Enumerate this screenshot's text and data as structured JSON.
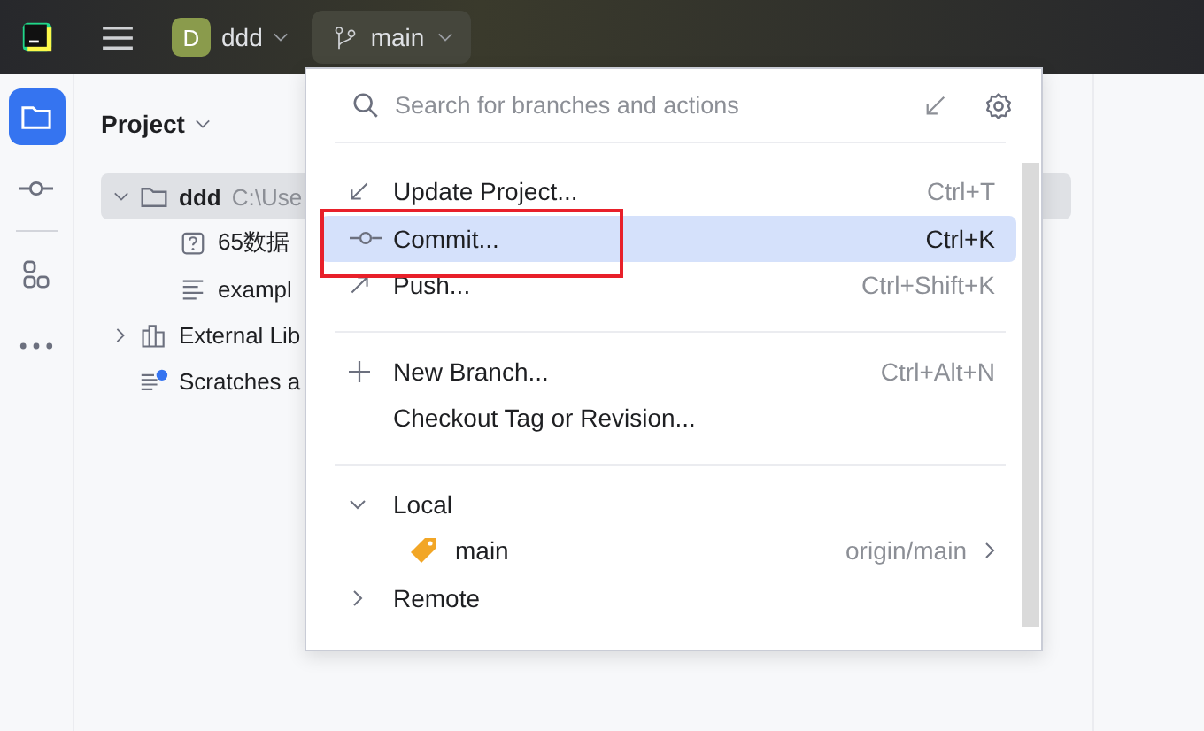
{
  "top_bar": {
    "project": {
      "badge": "D",
      "name": "ddd"
    },
    "branch": {
      "name": "main"
    }
  },
  "tool_strip": [
    {
      "kind": "folder",
      "selected": true
    },
    {
      "kind": "commit",
      "selected": false
    },
    {
      "kind": "structure",
      "selected": false
    },
    {
      "kind": "more",
      "selected": false
    }
  ],
  "project_panel": {
    "title": "Project",
    "tree": [
      {
        "kind": "folder",
        "label": "ddd",
        "path": "C:\\Use",
        "expanded": true,
        "selected": true,
        "children": [
          {
            "kind": "unknown",
            "label": "65数据",
            "selected": false
          },
          {
            "kind": "text",
            "label": "exampl",
            "selected": false
          }
        ]
      },
      {
        "kind": "library",
        "label": "External Lib",
        "expanded": false,
        "selected": false
      },
      {
        "kind": "scratches",
        "label": "Scratches a",
        "selected": false
      }
    ]
  },
  "branch_popup": {
    "search": {
      "placeholder": "Search for branches and actions"
    },
    "groups": [
      [
        {
          "kind": "update",
          "label": "Update Project...",
          "shortcut": "Ctrl+T",
          "selected": false
        },
        {
          "kind": "commit",
          "label": "Commit...",
          "shortcut": "Ctrl+K",
          "selected": true
        },
        {
          "kind": "push",
          "label": "Push...",
          "shortcut": "Ctrl+Shift+K",
          "selected": false
        }
      ],
      [
        {
          "kind": "new",
          "label": "New Branch...",
          "shortcut": "Ctrl+Alt+N",
          "selected": false
        },
        {
          "kind": "plain",
          "label": "Checkout Tag or Revision...",
          "selected": false
        }
      ]
    ],
    "branches": [
      {
        "label": "Local",
        "expanded": true,
        "children": [
          {
            "label": "main",
            "tracking": "origin/main"
          }
        ]
      },
      {
        "label": "Remote",
        "expanded": false
      }
    ]
  }
}
